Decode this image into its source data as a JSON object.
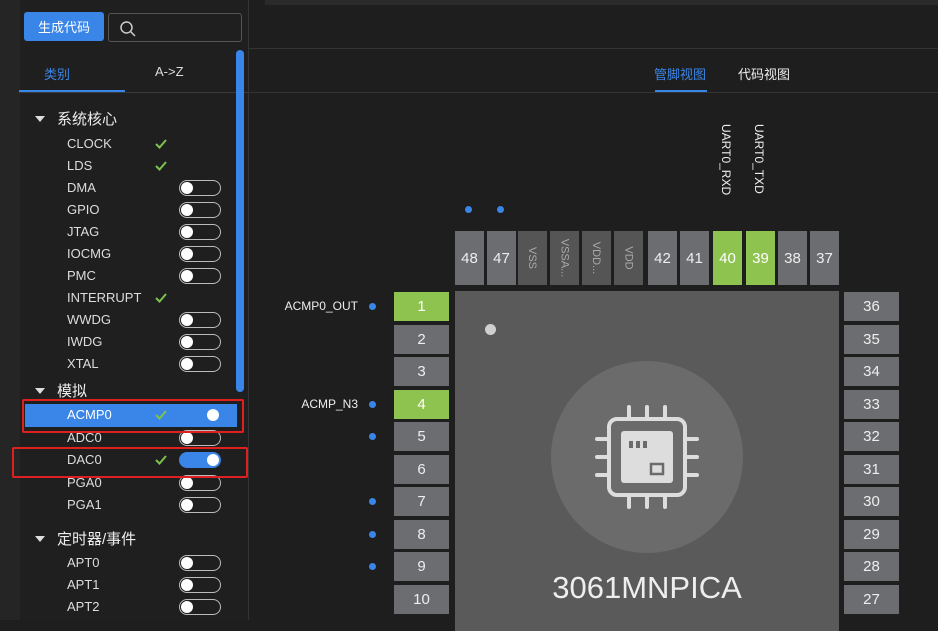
{
  "toolbar": {
    "generate_label": "生成代码",
    "search_placeholder": ""
  },
  "left_tabs": {
    "category": "类别",
    "az": "A->Z"
  },
  "categories": [
    {
      "name": "系统核心",
      "items": [
        "CLOCK",
        "LDS",
        "DMA",
        "GPIO",
        "JTAG",
        "IOCMG",
        "PMC",
        "INTERRUPT",
        "WWDG",
        "IWDG",
        "XTAL"
      ]
    },
    {
      "name": "模拟",
      "items": [
        "ACMP0",
        "ADC0",
        "DAC0",
        "PGA0",
        "PGA1"
      ]
    },
    {
      "name": "定时器/事件",
      "items": [
        "APT0",
        "APT1",
        "APT2"
      ]
    }
  ],
  "item_states": {
    "CLOCK": "check",
    "LDS": "check",
    "DMA": "none",
    "GPIO": "none",
    "JTAG": "off",
    "IOCMG": "none",
    "PMC": "off",
    "INTERRUPT": "check",
    "WWDG": "off",
    "IWDG": "off",
    "XTAL": "off",
    "ACMP0": "check-on",
    "ADC0": "off",
    "DAC0": "check-on",
    "PGA0": "off",
    "PGA1": "off",
    "APT0": "off",
    "APT1": "off",
    "APT2": "off"
  },
  "right_tabs": {
    "pin_view": "管脚视图",
    "code_view": "代码视图"
  },
  "chip": {
    "name": "3061MNPICA"
  },
  "top_pins": [
    "48",
    "47",
    "VSS",
    "VSSA...",
    "VDD...",
    "VDD",
    "42",
    "41",
    "40",
    "39",
    "38",
    "37"
  ],
  "top_pin_labels": {
    "40": "UART0_RXD",
    "39": "UART0_TXD"
  },
  "left_pins": [
    "1",
    "2",
    "3",
    "4",
    "5",
    "6",
    "7",
    "8",
    "9",
    "10"
  ],
  "left_pin_labels": {
    "1": "ACMP0_OUT",
    "4": "ACMP_N3"
  },
  "right_pins": [
    "36",
    "35",
    "34",
    "33",
    "32",
    "31",
    "30",
    "29",
    "28",
    "27"
  ],
  "colors": {
    "accent": "#3a86e8",
    "pin_highlight": "#8fc34f",
    "selection_box": "#e02020"
  }
}
